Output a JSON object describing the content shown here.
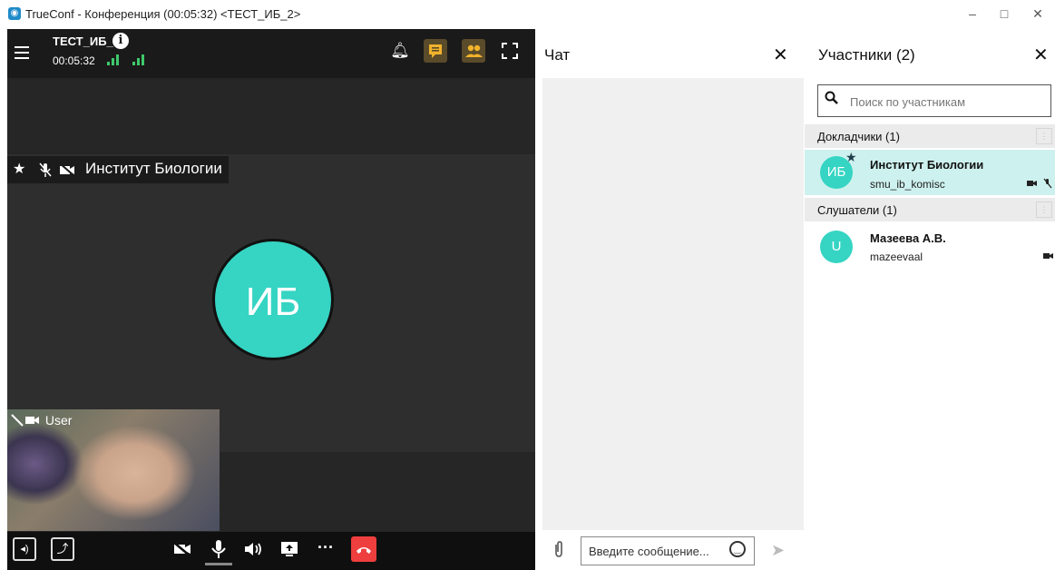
{
  "window": {
    "title": "TrueConf - Конференция (00:05:32) <ТЕСТ_ИБ_2>",
    "minimize": "–",
    "maximize": "□",
    "close": "✕"
  },
  "conference": {
    "title": "ТЕСТ_ИБ_2",
    "timer": "00:05:32"
  },
  "video": {
    "speaker_name": "Институт Биологии",
    "avatar_initials": "ИБ",
    "self_label": "User"
  },
  "chat": {
    "title": "Чат",
    "input_placeholder": "Введите сообщение..."
  },
  "participants": {
    "title": "Участники (2)",
    "search_placeholder": "Поиск по участникам",
    "groups": [
      {
        "label": "Докладчики (1)",
        "members": [
          {
            "initials": "ИБ",
            "name": "Институт Биологии",
            "login": "smu_ib_komisc"
          }
        ]
      },
      {
        "label": "Слушатели (1)",
        "members": [
          {
            "initials": "U",
            "name": "Мазеева А.В.",
            "login": "mazeevaal"
          }
        ]
      }
    ]
  },
  "colors": {
    "accent_teal": "#35d4c3",
    "hangup_red": "#ef3e3e",
    "selected_row": "#cdf1ee",
    "signal_green": "#3ec96b"
  },
  "icons": [
    "menu-icon",
    "info-icon",
    "signal-icon",
    "bell-icon",
    "chat-icon",
    "participants-icon",
    "fullscreen-icon",
    "star-icon",
    "mic-off-icon",
    "camera-off-icon",
    "speaker-icon",
    "share-icon",
    "camera-icon",
    "mic-icon",
    "volume-icon",
    "screen-share-icon",
    "more-icon",
    "hangup-icon",
    "attach-icon",
    "emoji-icon",
    "send-icon",
    "search-icon",
    "close-icon"
  ]
}
